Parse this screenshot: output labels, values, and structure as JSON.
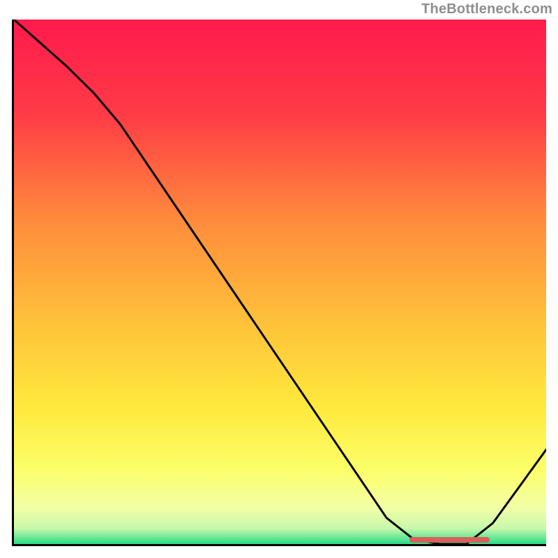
{
  "attribution": "TheBottleneck.com",
  "colors": {
    "gradient_stops": [
      {
        "offset": "0%",
        "color": "#ff1a4d"
      },
      {
        "offset": "18%",
        "color": "#ff3b46"
      },
      {
        "offset": "38%",
        "color": "#ff8a3c"
      },
      {
        "offset": "58%",
        "color": "#ffc23a"
      },
      {
        "offset": "74%",
        "color": "#ffe93d"
      },
      {
        "offset": "86%",
        "color": "#fcff6a"
      },
      {
        "offset": "93%",
        "color": "#f3ffa6"
      },
      {
        "offset": "97%",
        "color": "#c8f8ab"
      },
      {
        "offset": "100%",
        "color": "#27dd88"
      }
    ],
    "marker": "#d9605a",
    "curve": "#000000"
  },
  "chart_data": {
    "type": "line",
    "title": "",
    "xlabel": "",
    "ylabel": "",
    "xlim": [
      0,
      100
    ],
    "ylim": [
      0,
      100
    ],
    "x": [
      0,
      5,
      10,
      15,
      20,
      25,
      30,
      35,
      40,
      45,
      50,
      55,
      60,
      65,
      70,
      75,
      80,
      85,
      90,
      95,
      100
    ],
    "values": [
      100,
      95.5,
      91,
      86,
      80,
      72.5,
      65,
      57.5,
      50,
      42.5,
      35,
      27.5,
      20,
      12.5,
      5,
      1,
      0,
      0,
      4,
      11,
      18
    ],
    "marker_range_x": [
      74,
      89
    ],
    "annotations": []
  }
}
